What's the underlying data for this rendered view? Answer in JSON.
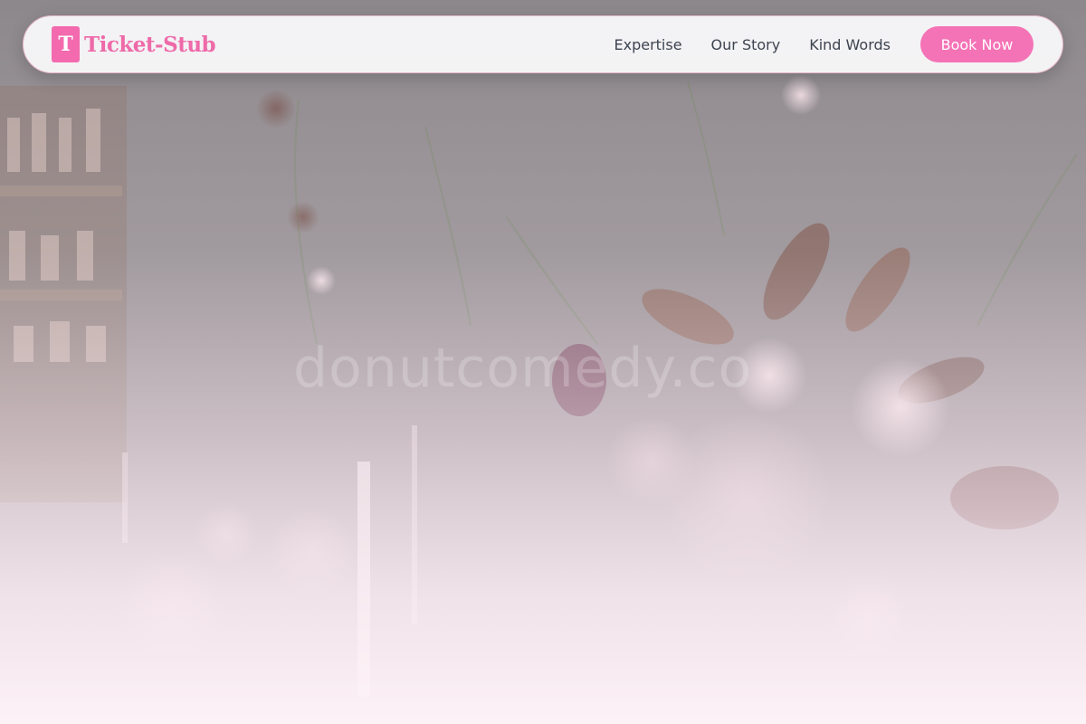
{
  "brand": {
    "mark_letter": "T",
    "name": "Ticket-Stub"
  },
  "nav": {
    "links": [
      "Expertise",
      "Our Story",
      "Kind Words"
    ],
    "cta_label": "Book Now"
  },
  "hero": {
    "watermark_text": "donutcomedy.co"
  },
  "colors": {
    "brand_pink": "#f472b6",
    "brand_text_pink": "#ee6aa9",
    "nav_text": "#3d4450",
    "navbar_bg": "#f7f7f8"
  },
  "icons": [
    "brand-logo-icon"
  ]
}
